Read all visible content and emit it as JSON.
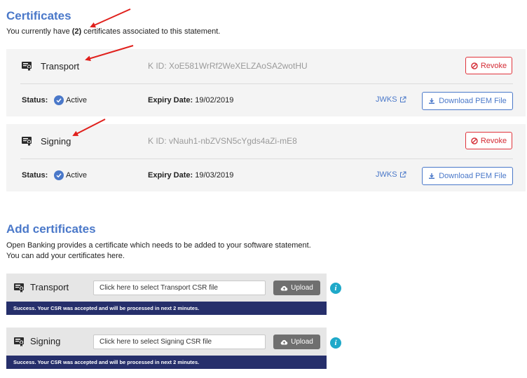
{
  "existing": {
    "title": "Certificates",
    "summary_prefix": "You currently have ",
    "summary_count": "(2)",
    "summary_suffix": " certificates associated to this statement."
  },
  "certificates": [
    {
      "name": "Transport",
      "kid": "K ID: XoE581WrRf2WeXELZAoSA2wotHU",
      "revoke_label": "Revoke",
      "status_label": "Status:",
      "status_value": "Active",
      "expiry_label": "Expiry Date:",
      "expiry_value": "19/02/2019",
      "jwks_label": "JWKS",
      "download_label": "Download PEM File"
    },
    {
      "name": "Signing",
      "kid": "K ID: vNauh1-nbZVSN5cYgds4aZi-mE8",
      "revoke_label": "Revoke",
      "status_label": "Status:",
      "status_value": "Active",
      "expiry_label": "Expiry Date:",
      "expiry_value": "19/03/2019",
      "jwks_label": "JWKS",
      "download_label": "Download PEM File"
    }
  ],
  "add": {
    "title": "Add certificates",
    "desc1": "Open Banking provides a certificate which needs to be added to your software statement.",
    "desc2": "You can add your certificates here."
  },
  "uploads": [
    {
      "name": "Transport",
      "placeholder": "Click here to select Transport CSR file",
      "upload_label": "Upload",
      "success": "Success. Your CSR was accepted and will be processed in next 2 minutes.",
      "info_glyph": "i"
    },
    {
      "name": "Signing",
      "placeholder": "Click here to select Signing CSR file",
      "upload_label": "Upload",
      "success": "Success. Your CSR was accepted and will be processed in next 2 minutes.",
      "info_glyph": "i"
    }
  ],
  "colors": {
    "accent": "#4a78c9",
    "danger": "#e0333b",
    "banner": "#262f6b",
    "info": "#1fa9c9",
    "annotation_arrow": "#e0201c"
  },
  "icons": {
    "certificate": "certificate-icon",
    "revoke": "ban-icon",
    "status": "check-circle-icon",
    "jwks": "external-link-icon",
    "download": "download-icon",
    "upload": "cloud-upload-icon",
    "info": "info-icon"
  }
}
